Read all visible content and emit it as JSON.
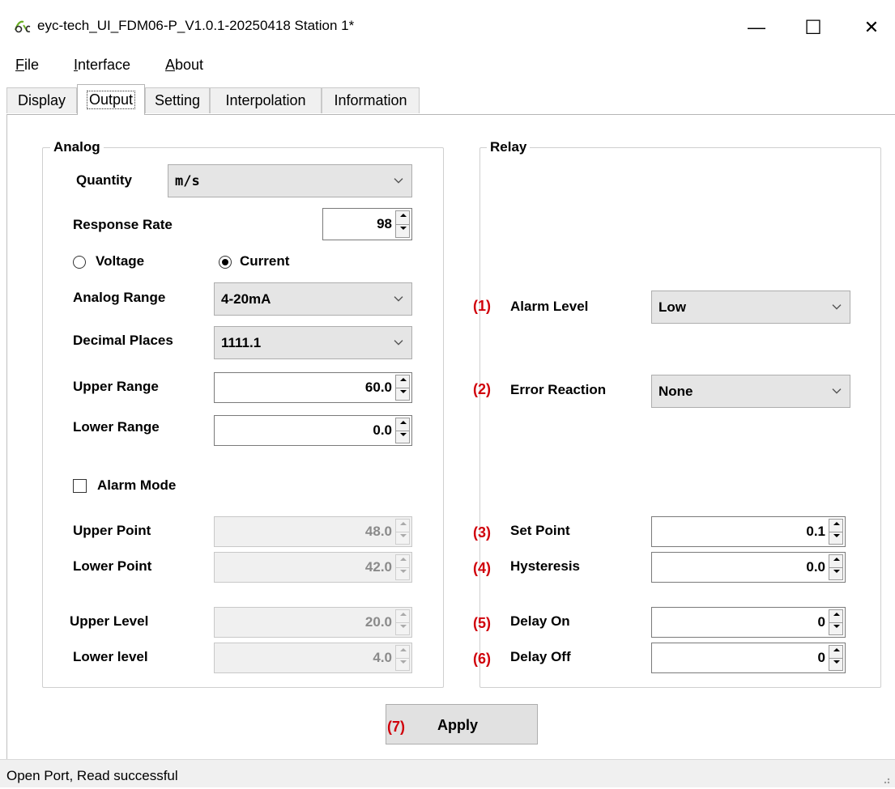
{
  "window": {
    "title": "eyc-tech_UI_FDM06-P_V1.0.1-20250418  Station 1*",
    "minimize": "—",
    "maximize": "☐",
    "close": "✕"
  },
  "menu": {
    "file_mnemonic": "F",
    "file_rest": "ile",
    "interface_mnemonic": "I",
    "interface_rest": "nterface",
    "about_mnemonic": "A",
    "about_rest": "bout"
  },
  "tabs": [
    "Display",
    "Output",
    "Setting",
    "Interpolation",
    "Information"
  ],
  "active_tab": "Output",
  "analog": {
    "title": "Analog",
    "quantity_label": "Quantity",
    "quantity_value": "m/s",
    "response_rate_label": "Response Rate",
    "response_rate_value": "98",
    "voltage_label": "Voltage",
    "current_label": "Current",
    "selected_mode": "Current",
    "analog_range_label": "Analog Range",
    "analog_range_value": "4-20mA",
    "decimal_places_label": "Decimal Places",
    "decimal_places_value": "1111.1",
    "upper_range_label": "Upper Range",
    "upper_range_value": "60.0",
    "lower_range_label": "Lower Range",
    "lower_range_value": "0.0",
    "alarm_mode_label": "Alarm Mode",
    "alarm_mode_checked": false,
    "upper_point_label": "Upper Point",
    "upper_point_value": "48.0",
    "lower_point_label": "Lower Point",
    "lower_point_value": "42.0",
    "upper_level_label": "Upper Level",
    "upper_level_value": "20.0",
    "lower_level_label": "Lower level",
    "lower_level_value": "4.0"
  },
  "relay": {
    "title": "Relay",
    "alarm_level_marker": "(1)",
    "alarm_level_label": "Alarm Level",
    "alarm_level_value": "Low",
    "error_reaction_marker": "(2)",
    "error_reaction_label": "Error Reaction",
    "error_reaction_value": "None",
    "set_point_marker": "(3)",
    "set_point_label": "Set Point",
    "set_point_value": "0.1",
    "hysteresis_marker": "(4)",
    "hysteresis_label": "Hysteresis",
    "hysteresis_value": "0.0",
    "delay_on_marker": "(5)",
    "delay_on_label": "Delay On",
    "delay_on_value": "0",
    "delay_off_marker": "(6)",
    "delay_off_label": "Delay Off",
    "delay_off_value": "0"
  },
  "apply": {
    "marker": "(7)",
    "label": "Apply"
  },
  "status": {
    "text": "Open Port,   Read successful"
  },
  "colors": {
    "annotation_red": "#d0000a",
    "combo_bg": "#e5e5e5",
    "disabled_text": "#8a8a8a"
  }
}
